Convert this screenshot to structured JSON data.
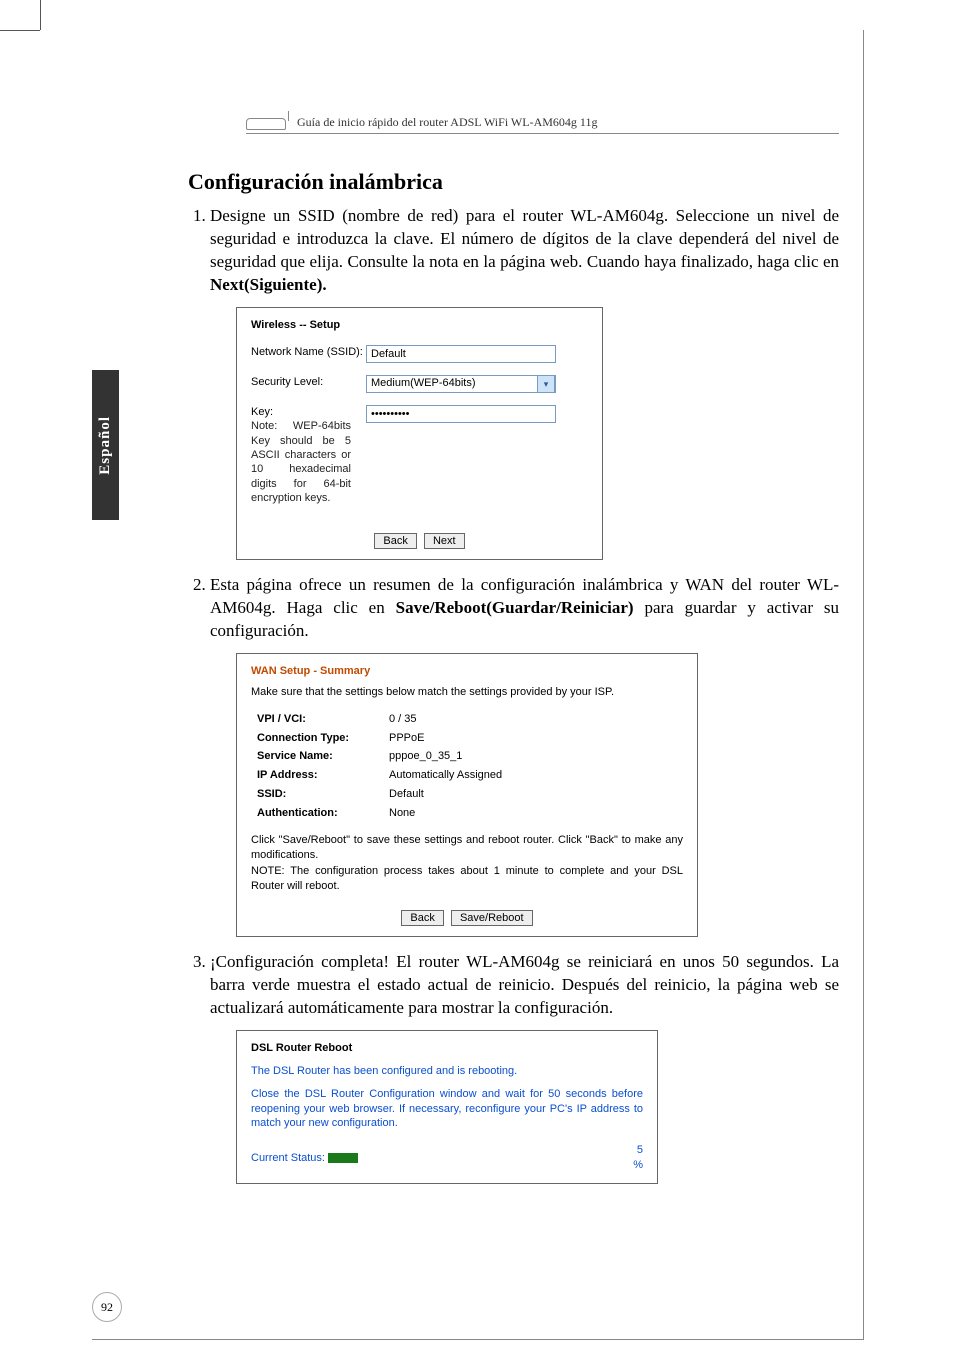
{
  "running_header": "Guía de inicio rápido del router ADSL WiFi WL-AM604g 11g",
  "section_title": "Configuración inalámbrica",
  "side_tab": "Español",
  "page_number": "92",
  "steps": {
    "s1_pre": "Designe un SSID (nombre de red) para el router WL-AM604g. Seleccione un nivel de seguridad e introduzca la clave. El número de dígitos de la clave dependerá del nivel de seguridad que elija. Consulte la nota en la página web. Cuando haya finalizado, haga clic en ",
    "s1_bold": "Next(Siguiente).",
    "s2_pre": "Esta página ofrece un resumen de la configuración inalámbrica y WAN del router WL-AM604g. Haga clic en ",
    "s2_bold": "Save/Reboot(Guardar/Reiniciar)",
    "s2_post": " para guardar y activar su configuración.",
    "s3": "¡Configuración completa! El router WL-AM604g se reiniciará en unos 50 segundos. La barra verde muestra el estado actual de reinicio. Después del reinicio, la página web se actualizará automáticamente para mostrar la configuración."
  },
  "wireless_setup": {
    "title": "Wireless -- Setup",
    "ssid_label": "Network Name (SSID):",
    "ssid_value": "Default",
    "sec_label": "Security Level:",
    "sec_value": "Medium(WEP-64bits)",
    "key_label": "Key:",
    "key_value": "••••••••••",
    "note": "Note: WEP-64bits Key should be 5 ASCII characters or 10 hexadecimal digits for 64-bit encryption keys.",
    "back": "Back",
    "next": "Next"
  },
  "wan_summary": {
    "title": "WAN Setup - Summary",
    "instruct": "Make sure that the settings below match the settings provided by your ISP.",
    "rows": [
      {
        "k": "VPI / VCI:",
        "v": "0 / 35"
      },
      {
        "k": "Connection Type:",
        "v": "PPPoE"
      },
      {
        "k": "Service Name:",
        "v": "pppoe_0_35_1"
      },
      {
        "k": "IP Address:",
        "v": "Automatically Assigned"
      },
      {
        "k": "SSID:",
        "v": "Default"
      },
      {
        "k": "Authentication:",
        "v": "None"
      }
    ],
    "note1": "Click \"Save/Reboot\" to save these settings and reboot router. Click \"Back\" to make any modifications.",
    "note2": "NOTE: The configuration process takes about 1 minute to complete and your DSL Router will reboot.",
    "back": "Back",
    "save": "Save/Reboot"
  },
  "reboot": {
    "title": "DSL Router Reboot",
    "line1": "The DSL Router has been configured and is rebooting.",
    "line2": "Close the DSL Router Configuration window and wait for 50 seconds before reopening your web browser. If necessary, reconfigure your PC's IP address to match your new configuration.",
    "status_label": "Current Status:",
    "percent": "5",
    "percent_sign": "%"
  }
}
